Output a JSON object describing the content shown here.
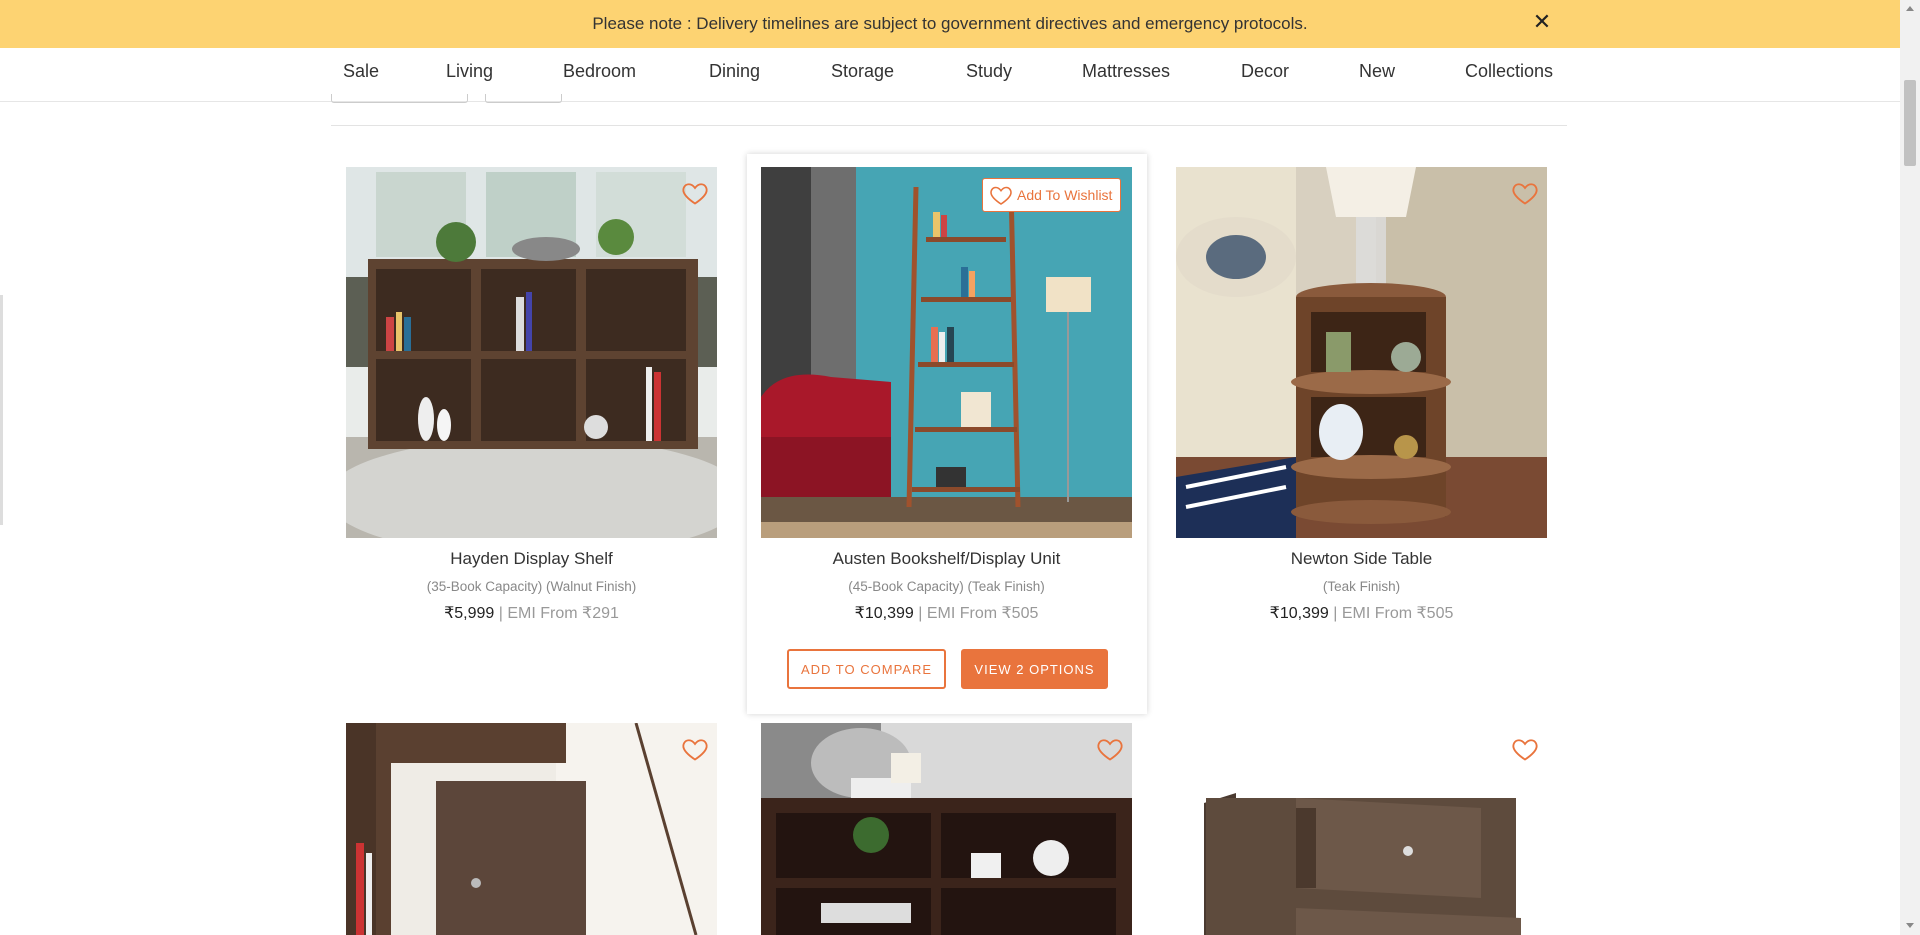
{
  "banner": {
    "text": "Please note : Delivery timelines are subject to government directives and emergency protocols.",
    "close_glyph": "✕"
  },
  "nav": {
    "items": [
      "Sale",
      "Living",
      "Bedroom",
      "Dining",
      "Storage",
      "Study",
      "Mattresses",
      "Decor",
      "New",
      "Collections"
    ]
  },
  "colors": {
    "banner_bg": "#fdd372",
    "accent": "#e9743d",
    "text": "#333333",
    "muted": "#888888"
  },
  "products": [
    {
      "name": "Hayden Display Shelf",
      "subtitle": "(35-Book Capacity) (Walnut Finish)",
      "price": "₹5,999",
      "emi": "| EMI From ₹291",
      "image_icon": "display-shelf-photo"
    },
    {
      "name": "Austen Bookshelf/Display Unit",
      "subtitle": "(45-Book Capacity) (Teak Finish)",
      "price": "₹10,399",
      "emi": "| EMI From ₹505",
      "wishlist_label": "Add To Wishlist",
      "compare_label": "ADD TO COMPARE",
      "options_label": "VIEW 2 OPTIONS",
      "image_icon": "ladder-bookshelf-photo"
    },
    {
      "name": "Newton Side Table",
      "subtitle": "(Teak Finish)",
      "price": "₹10,399",
      "emi": "| EMI From ₹505",
      "image_icon": "round-side-table-photo"
    }
  ],
  "row2": [
    {
      "image_icon": "cabinet-door-photo"
    },
    {
      "image_icon": "low-bookshelf-photo"
    },
    {
      "image_icon": "drawer-unit-photo"
    }
  ]
}
